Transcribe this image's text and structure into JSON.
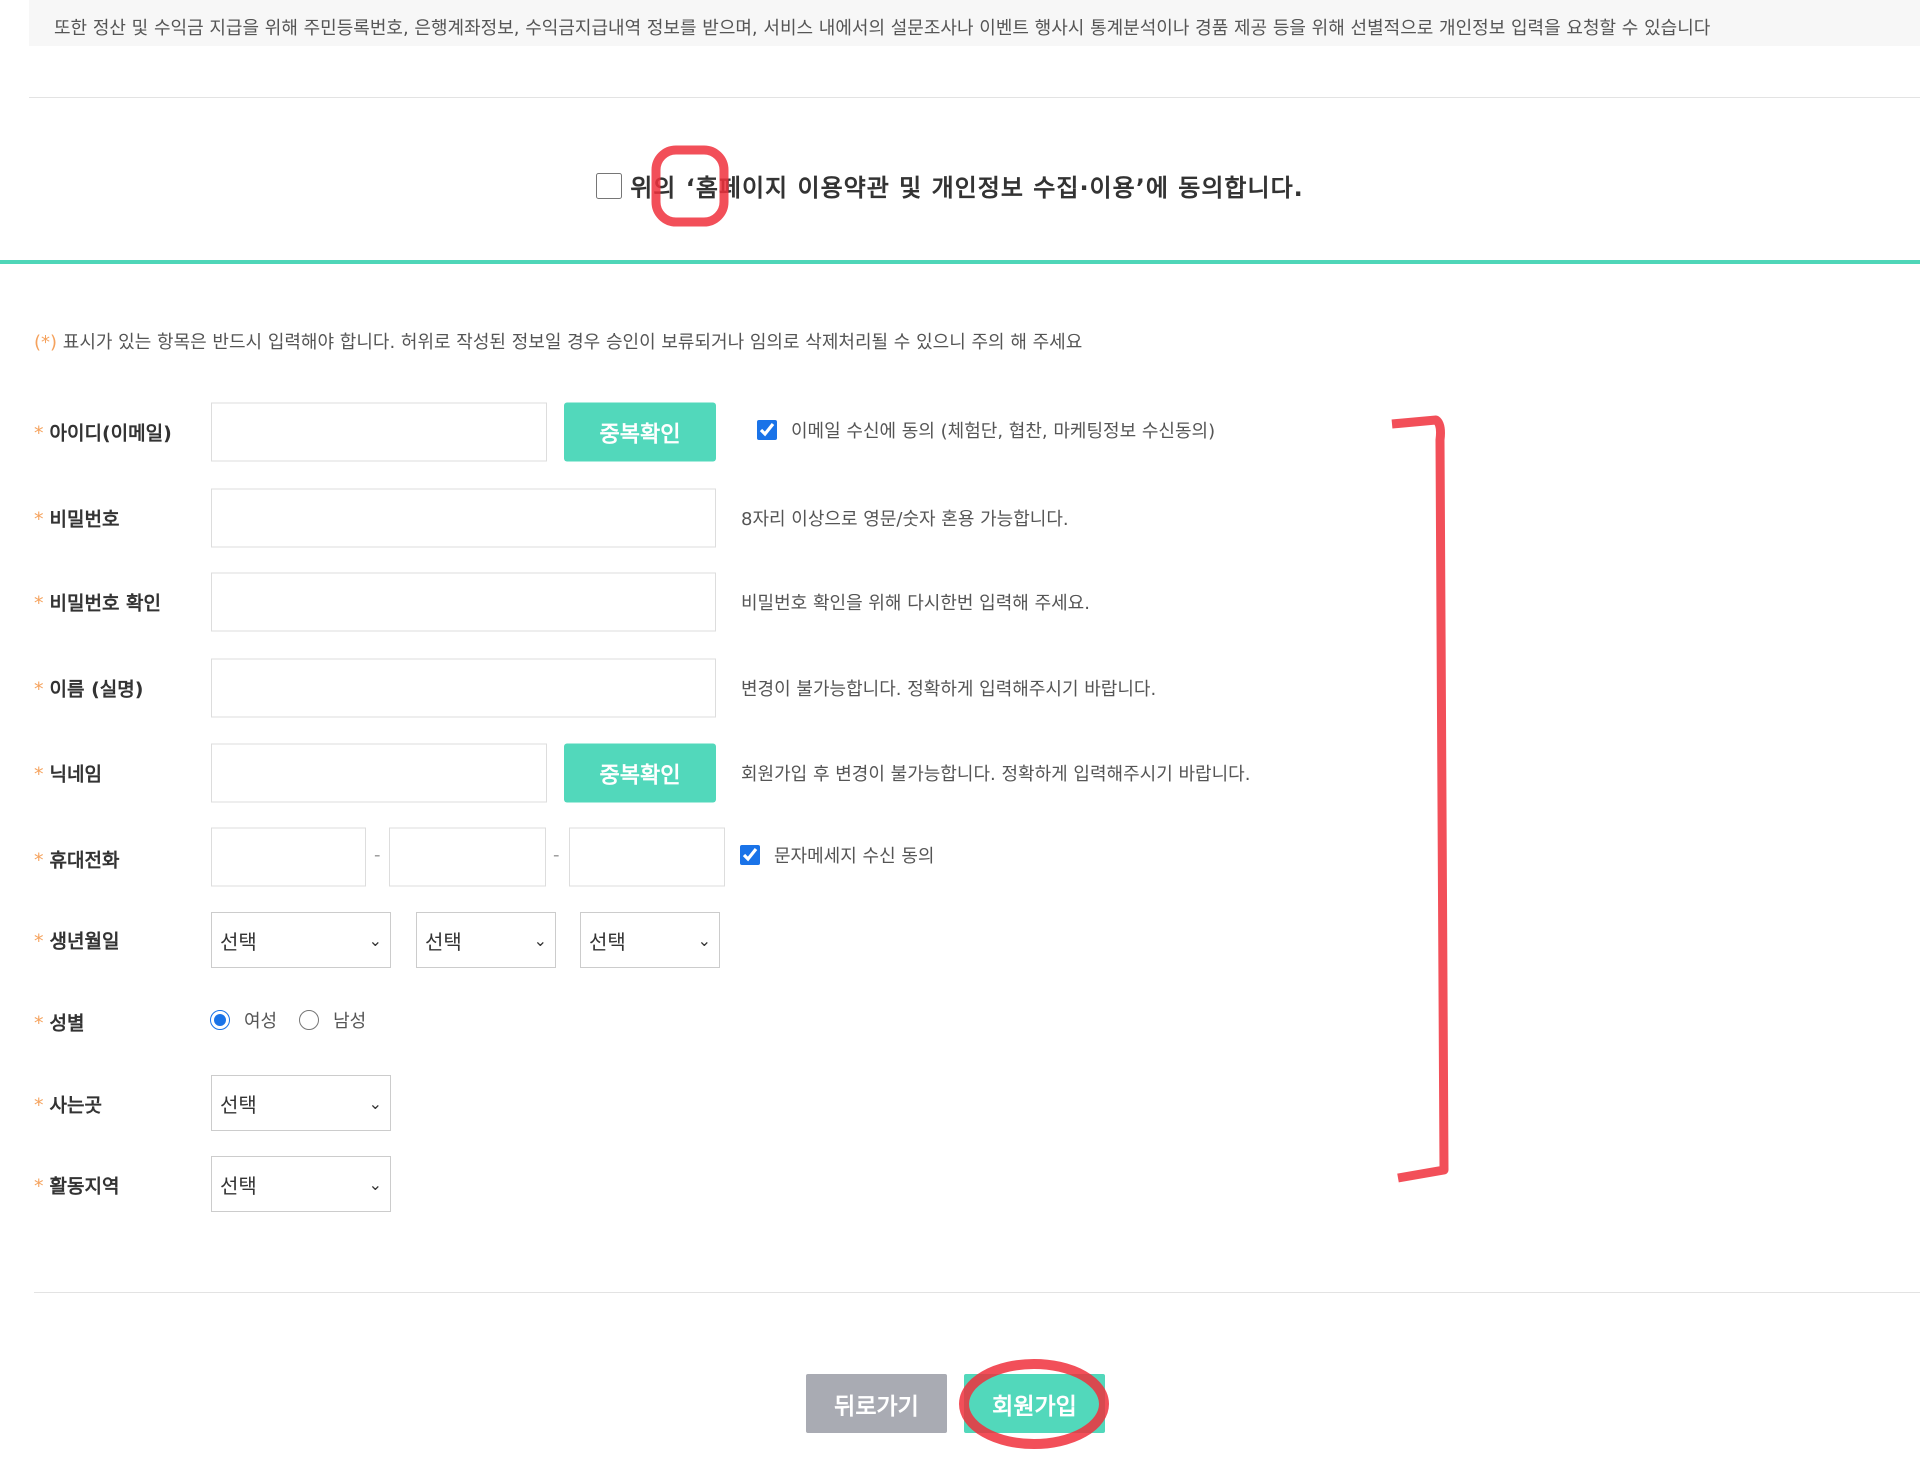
{
  "terms_text": "또한 정산 및 수익금 지급을 위해 주민등록번호, 은행계좌정보, 수익금지급내역 정보를 받으며, 서비스 내에서의 설문조사나 이벤트 행사시 통계분석이나 경품 제공 등을 위해 선별적으로 개인정보 입력을 요청할 수 있습니다",
  "agree_label": "위의 ‘홈페이지 이용약관 및 개인정보 수집·이용’에 동의합니다.",
  "notice": {
    "star": "(*)",
    "text": " 표시가 있는 항목은 반드시 입력해야 합니다. 허위로 작성된 정보일 경우 승인이 보류되거나 임의로 삭제처리될 수 있으니 주의 해 주세요"
  },
  "star": "*",
  "fields": {
    "id": {
      "label": "아이디(이메일)",
      "button": "중복확인",
      "consent": "이메일 수신에 동의 (체험단, 협찬, 마케팅정보 수신동의)",
      "consent_checked": true
    },
    "password": {
      "label": "비밀번호",
      "hint": "8자리 이상으로 영문/숫자 혼용 가능합니다."
    },
    "password_confirm": {
      "label": "비밀번호 확인",
      "hint": "비밀번호 확인을 위해 다시한번 입력해 주세요."
    },
    "name": {
      "label": "이름 (실명)",
      "hint": "변경이 불가능합니다. 정확하게 입력해주시기 바랍니다."
    },
    "nickname": {
      "label": "닉네임",
      "button": "중복확인",
      "hint": "회원가입 후 변경이 불가능합니다. 정확하게 입력해주시기 바랍니다."
    },
    "phone": {
      "label": "휴대전화",
      "sep": "-",
      "consent": "문자메세지 수신 동의",
      "consent_checked": true
    },
    "birth": {
      "label": "생년월일",
      "year": "선택",
      "month": "선택",
      "day": "선택"
    },
    "gender": {
      "label": "성별",
      "options": [
        "여성",
        "남성"
      ],
      "selected": "여성"
    },
    "residence": {
      "label": "사는곳",
      "value": "선택"
    },
    "area": {
      "label": "활동지역",
      "value": "선택"
    }
  },
  "buttons": {
    "back": "뒤로가기",
    "join": "회원가입"
  },
  "colors": {
    "accent": "#52d8bb",
    "back": "#a9abb3",
    "annotation": "#f0303c"
  }
}
